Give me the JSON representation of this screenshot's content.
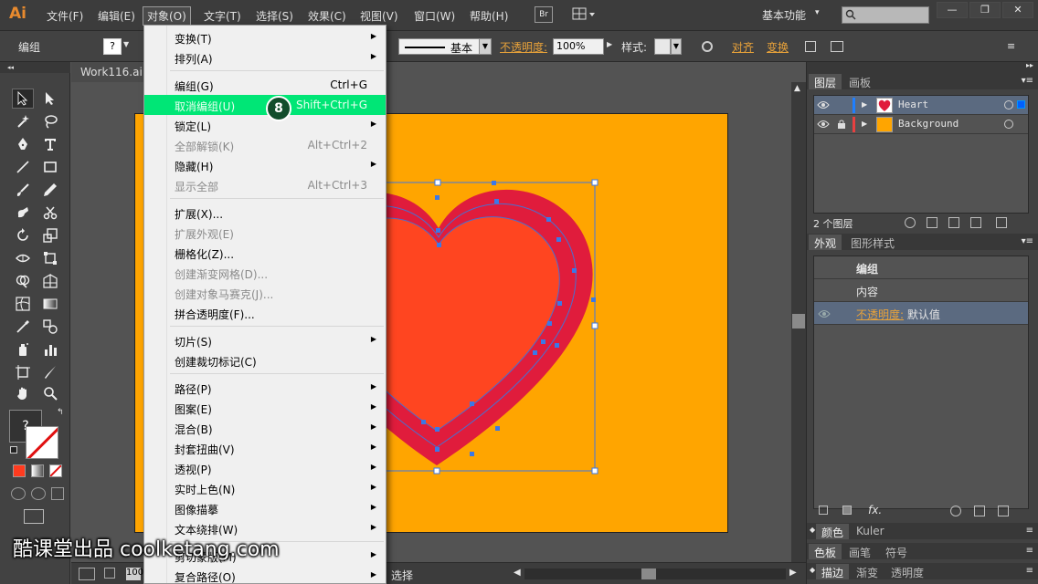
{
  "app": {
    "logo": "Ai",
    "menu": [
      "文件(F)",
      "编辑(E)",
      "对象(O)",
      "文字(T)",
      "选择(S)",
      "效果(C)",
      "视图(V)",
      "窗口(W)",
      "帮助(H)"
    ],
    "bridge_label": "Br",
    "workspace": "基本功能",
    "window_buttons": [
      "—",
      "❐",
      "✕"
    ]
  },
  "control_bar": {
    "selection_label": "编组",
    "fill_label": "?",
    "stroke_profile": "基本",
    "opacity_label": "不透明度:",
    "opacity_value": "100%",
    "style_label": "样式:",
    "align_label": "对齐",
    "transform_label": "变换"
  },
  "document": {
    "tab_title": "Work116.ai"
  },
  "tools": {
    "fill_question": "?"
  },
  "object_menu": {
    "step_badge": "8",
    "items": [
      {
        "label": "变换(T)",
        "shortcut": "",
        "submenu": true,
        "disabled": false
      },
      {
        "label": "排列(A)",
        "shortcut": "",
        "submenu": true,
        "disabled": false
      },
      {
        "label": "编组(G)",
        "shortcut": "Ctrl+G",
        "submenu": false,
        "disabled": false
      },
      {
        "label": "取消编组(U)",
        "shortcut": "Shift+Ctrl+G",
        "submenu": false,
        "disabled": false,
        "highlighted": true
      },
      {
        "label": "锁定(L)",
        "shortcut": "",
        "submenu": true,
        "disabled": false
      },
      {
        "label": "全部解锁(K)",
        "shortcut": "Alt+Ctrl+2",
        "submenu": false,
        "disabled": true
      },
      {
        "label": "隐藏(H)",
        "shortcut": "",
        "submenu": true,
        "disabled": false
      },
      {
        "label": "显示全部",
        "shortcut": "Alt+Ctrl+3",
        "submenu": false,
        "disabled": true
      },
      {
        "label": "扩展(X)...",
        "shortcut": "",
        "submenu": false,
        "disabled": false
      },
      {
        "label": "扩展外观(E)",
        "shortcut": "",
        "submenu": false,
        "disabled": true
      },
      {
        "label": "栅格化(Z)...",
        "shortcut": "",
        "submenu": false,
        "disabled": false
      },
      {
        "label": "创建渐变网格(D)...",
        "shortcut": "",
        "submenu": false,
        "disabled": true
      },
      {
        "label": "创建对象马赛克(J)...",
        "shortcut": "",
        "submenu": false,
        "disabled": true
      },
      {
        "label": "拼合透明度(F)...",
        "shortcut": "",
        "submenu": false,
        "disabled": false
      },
      {
        "label": "切片(S)",
        "shortcut": "",
        "submenu": true,
        "disabled": false
      },
      {
        "label": "创建裁切标记(C)",
        "shortcut": "",
        "submenu": false,
        "disabled": false
      },
      {
        "label": "路径(P)",
        "shortcut": "",
        "submenu": true,
        "disabled": false
      },
      {
        "label": "图案(E)",
        "shortcut": "",
        "submenu": true,
        "disabled": false
      },
      {
        "label": "混合(B)",
        "shortcut": "",
        "submenu": true,
        "disabled": false
      },
      {
        "label": "封套扭曲(V)",
        "shortcut": "",
        "submenu": true,
        "disabled": false
      },
      {
        "label": "透视(P)",
        "shortcut": "",
        "submenu": true,
        "disabled": false
      },
      {
        "label": "实时上色(N)",
        "shortcut": "",
        "submenu": true,
        "disabled": false
      },
      {
        "label": "图像描摹",
        "shortcut": "",
        "submenu": true,
        "disabled": false
      },
      {
        "label": "文本绕排(W)",
        "shortcut": "",
        "submenu": true,
        "disabled": false
      },
      {
        "label": "剪切蒙版(M)",
        "shortcut": "",
        "submenu": true,
        "disabled": false
      },
      {
        "label": "复合路径(O)",
        "shortcut": "",
        "submenu": true,
        "disabled": false
      }
    ]
  },
  "layers_panel": {
    "tabs": [
      "图层",
      "画板"
    ],
    "layers": [
      {
        "name": "Heart",
        "selected": true,
        "color": "#1f7fff",
        "locked": false
      },
      {
        "name": "Background",
        "selected": false,
        "color": "#e84040",
        "locked": true
      }
    ],
    "count_label": "2 个图层"
  },
  "appearance_panel": {
    "tabs": [
      "外观",
      "图形样式"
    ],
    "rows": {
      "group": "编组",
      "contents": "内容",
      "opacity_label": "不透明度:",
      "opacity_value": "默认值"
    },
    "fx_label": "fx."
  },
  "bottom_panels": {
    "row1": [
      "颜色",
      "Kuler"
    ],
    "row2": [
      "色板",
      "画笔",
      "符号"
    ],
    "row3": [
      "描边",
      "渐变",
      "透明度"
    ]
  },
  "status_bar": {
    "zoom": "100",
    "tool_name": "选择"
  },
  "watermark": "酷课堂出品 coolketang.com",
  "colors": {
    "artboard": "#ffa500",
    "heart_stroke": "#e01c3c",
    "heart_fill": "#ff4520",
    "menu_highlight": "#00e676",
    "accent_link": "#e8a23a"
  }
}
